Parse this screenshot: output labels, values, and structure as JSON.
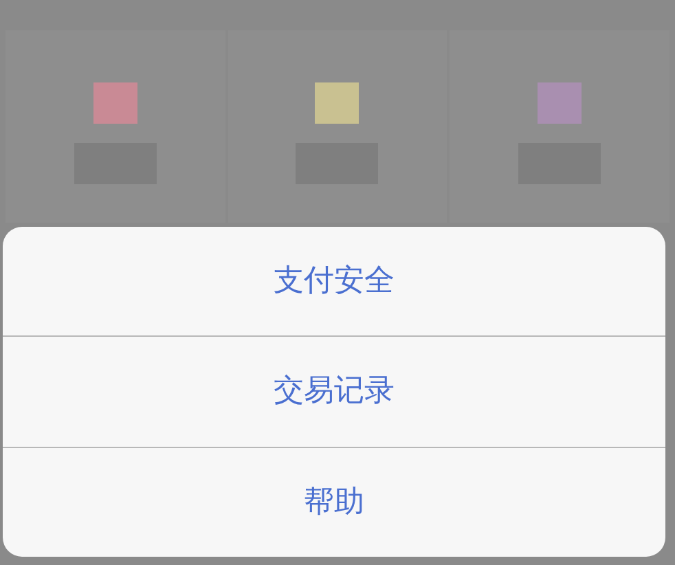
{
  "service_grid": {
    "tiles": [
      {
        "color": "#c98a95"
      },
      {
        "color": "#c9c191"
      },
      {
        "color": "#a98fb0"
      }
    ]
  },
  "action_sheet": {
    "options": [
      {
        "label": "支付安全"
      },
      {
        "label": "交易记录"
      },
      {
        "label": "帮助"
      }
    ]
  }
}
